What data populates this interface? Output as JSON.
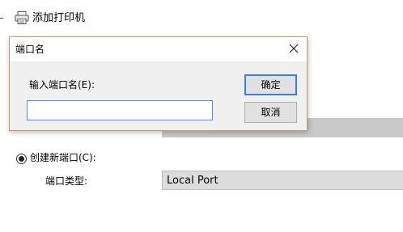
{
  "wizard": {
    "title": "添加打印机",
    "create_port_option": "创建新端口(C):",
    "port_type_label": "端口类型:",
    "port_type_value": "Local Port"
  },
  "dialog": {
    "title": "端口名",
    "prompt": "输入端口名(E):",
    "input_value": "",
    "input_placeholder": "",
    "ok_label": "确定",
    "cancel_label": "取消"
  },
  "icons": {
    "wizard_icon": "printer-icon",
    "close": "close-icon"
  },
  "colors": {
    "dialog_border": "#c49a6c",
    "focus_blue": "#3c7fd1",
    "dialog_bg": "#f0f0f0"
  }
}
